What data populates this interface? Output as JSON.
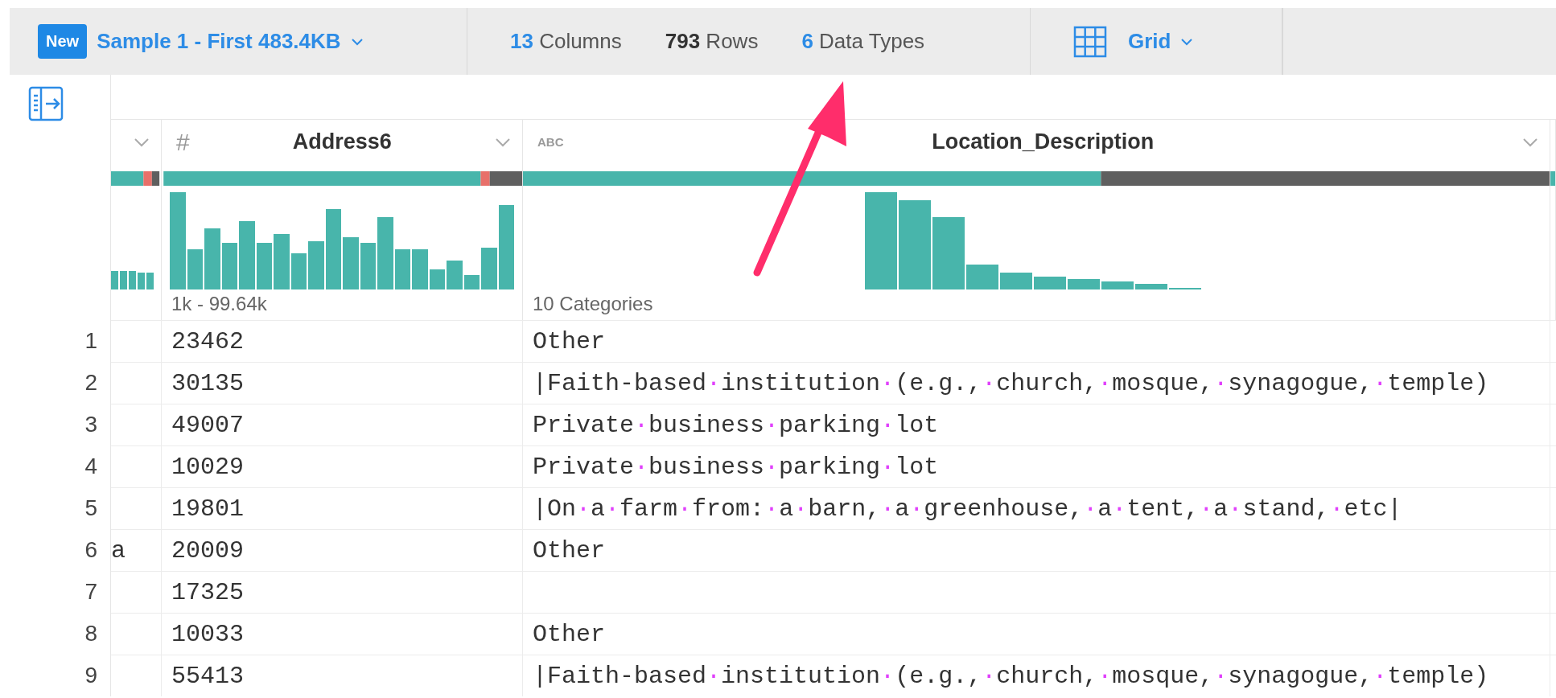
{
  "toolbar": {
    "badge": "New",
    "sample": "Sample 1 - First 483.4KB",
    "stats": [
      {
        "value": "13",
        "label": "Columns",
        "kind": "link"
      },
      {
        "value": "793",
        "label": "Rows",
        "kind": "plain"
      },
      {
        "value": "6",
        "label": "Data Types",
        "kind": "link"
      }
    ],
    "view": "Grid"
  },
  "columns": [
    {
      "kind": "partial"
    },
    {
      "kind": "numeric",
      "type_label": "#",
      "name": "Address6",
      "summary": "1k - 99.64k"
    },
    {
      "kind": "text",
      "type_label": "ABC",
      "name": "Location_Description",
      "summary": "10 Categories"
    }
  ],
  "rows": [
    {
      "number": "1",
      "address6": "23462",
      "location_description": "Other"
    },
    {
      "number": "2",
      "address6": "30135",
      "location_description": "|Faith-based·institution·(e.g.,·church,·mosque,·synagogue,·temple)"
    },
    {
      "number": "3",
      "address6": "49007",
      "location_description": "Private·business·parking·lot"
    },
    {
      "number": "4",
      "address6": "10029",
      "location_description": "Private·business·parking·lot"
    },
    {
      "number": "5",
      "address6": "19801",
      "location_description": "|On·a·farm·from:·a·barn,·a·greenhouse,·a·tent,·a·stand,·etc|"
    },
    {
      "number": "6",
      "column_1": "a",
      "address6": "20009",
      "location_description": "Other"
    },
    {
      "number": "7",
      "address6": "17325"
    },
    {
      "number": "8",
      "address6": "10033",
      "location_description": "Other"
    },
    {
      "number": "9",
      "address6": "55413",
      "location_description": "|Faith-based·institution·(e.g.,·church,·mosque,·synagogue,·temple)"
    }
  ]
}
